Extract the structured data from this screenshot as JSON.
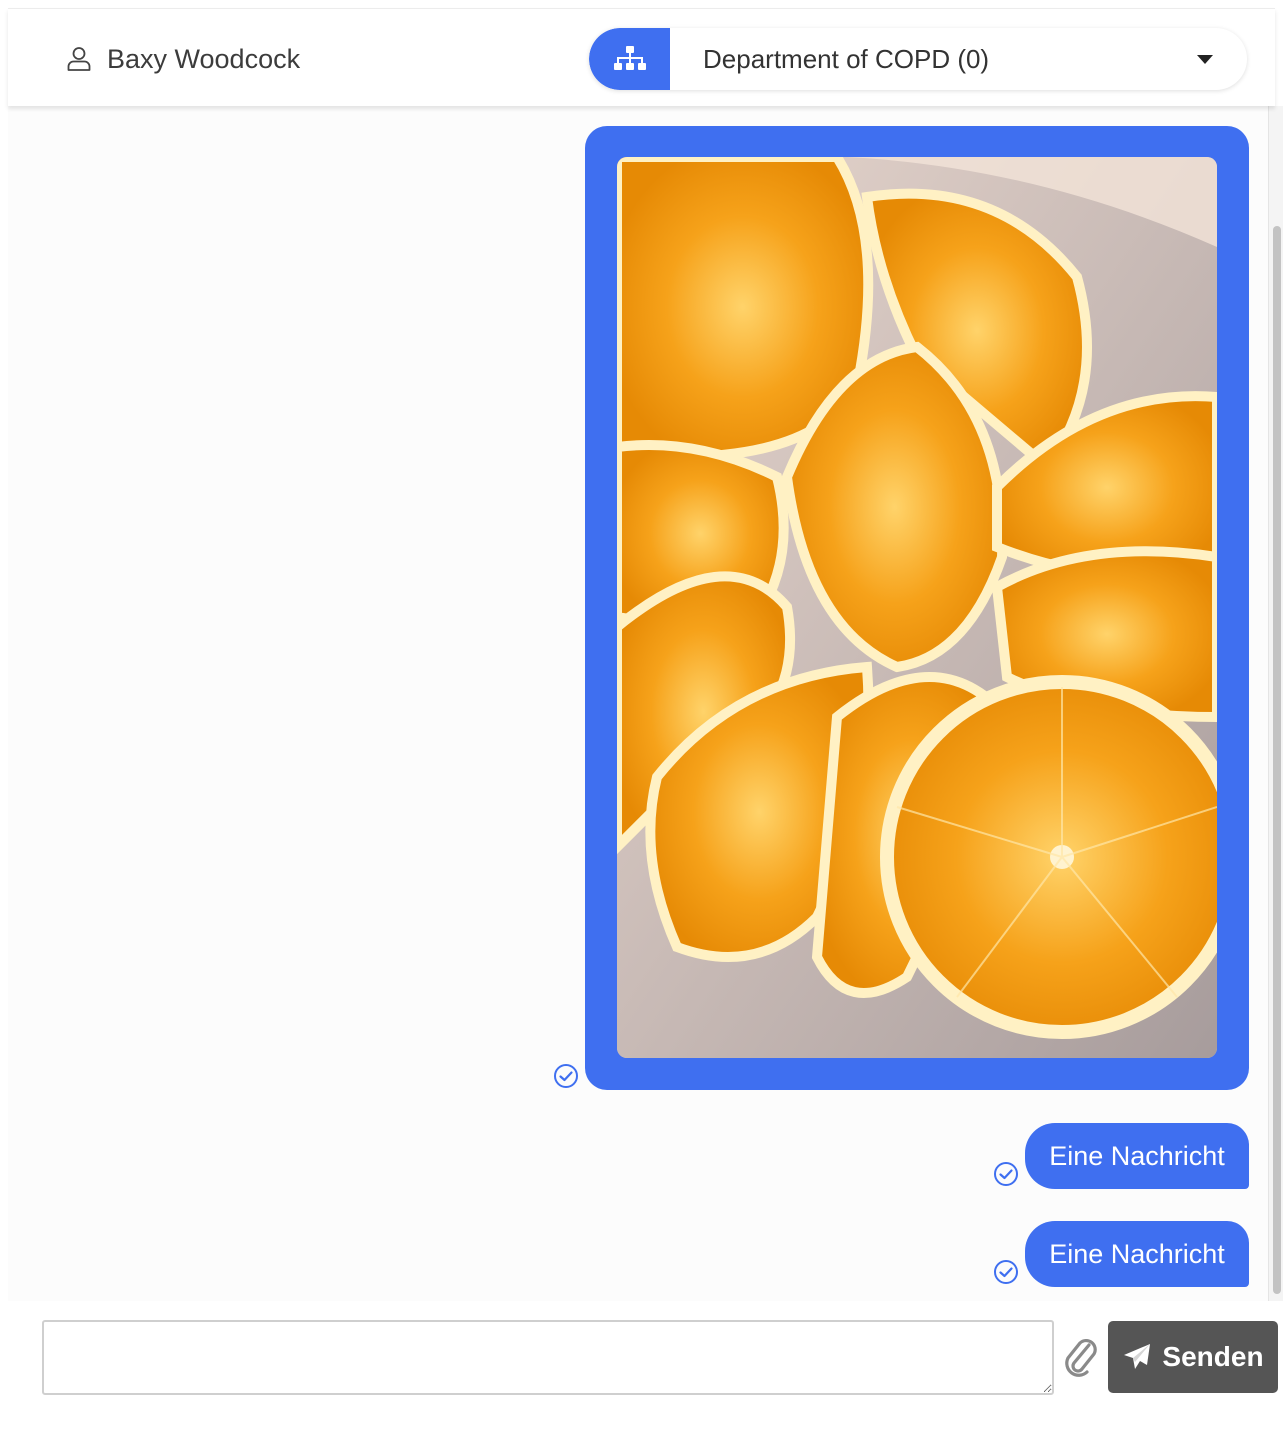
{
  "header": {
    "user_name": "Baxy Woodcock",
    "department_label": "Department of COPD (0)",
    "accent_color": "#3f6ff0"
  },
  "messages": [
    {
      "type": "image",
      "status_icon": "read-check-icon"
    },
    {
      "type": "text",
      "text": "Eine Nachricht",
      "status_icon": "read-check-icon"
    },
    {
      "type": "text",
      "text": "Eine Nachricht",
      "status_icon": "read-check-icon"
    }
  ],
  "composer": {
    "value": "",
    "placeholder": "",
    "attach_icon": "paperclip-icon",
    "send_label": "Senden",
    "send_icon": "paper-plane-icon"
  }
}
